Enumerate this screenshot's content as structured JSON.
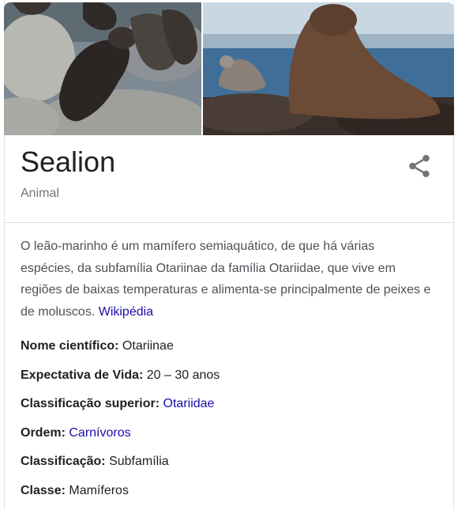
{
  "header": {
    "title": "Sealion",
    "subtitle": "Animal"
  },
  "images": {
    "left_label": "sea-lions-on-rocks-photo",
    "right_label": "sea-lion-by-sea-photo"
  },
  "description": {
    "text": "O leão-marinho é um mamífero semiaquático, de que há várias espécies, da subfamília Otariinae da família Otariidae, que vive em regiões de baixas temperaturas e alimenta-se principalmente de peixes e de moluscos.",
    "source_link": "Wikipédia"
  },
  "facts": [
    {
      "label": "Nome científico:",
      "value": "Otariinae",
      "link": false
    },
    {
      "label": "Expectativa de Vida:",
      "value": "20 – 30 anos",
      "link": false
    },
    {
      "label": "Classificação superior:",
      "value": "Otariidae",
      "link": true
    },
    {
      "label": "Ordem:",
      "value": "Carnívoros",
      "link": true
    },
    {
      "label": "Classificação:",
      "value": "Subfamília",
      "link": false
    },
    {
      "label": "Classe:",
      "value": "Mamíferos",
      "link": false
    }
  ],
  "colors": {
    "link": "#1a0dab",
    "text": "#202124",
    "muted": "#70757a"
  },
  "icons": {
    "share": "share-icon"
  }
}
